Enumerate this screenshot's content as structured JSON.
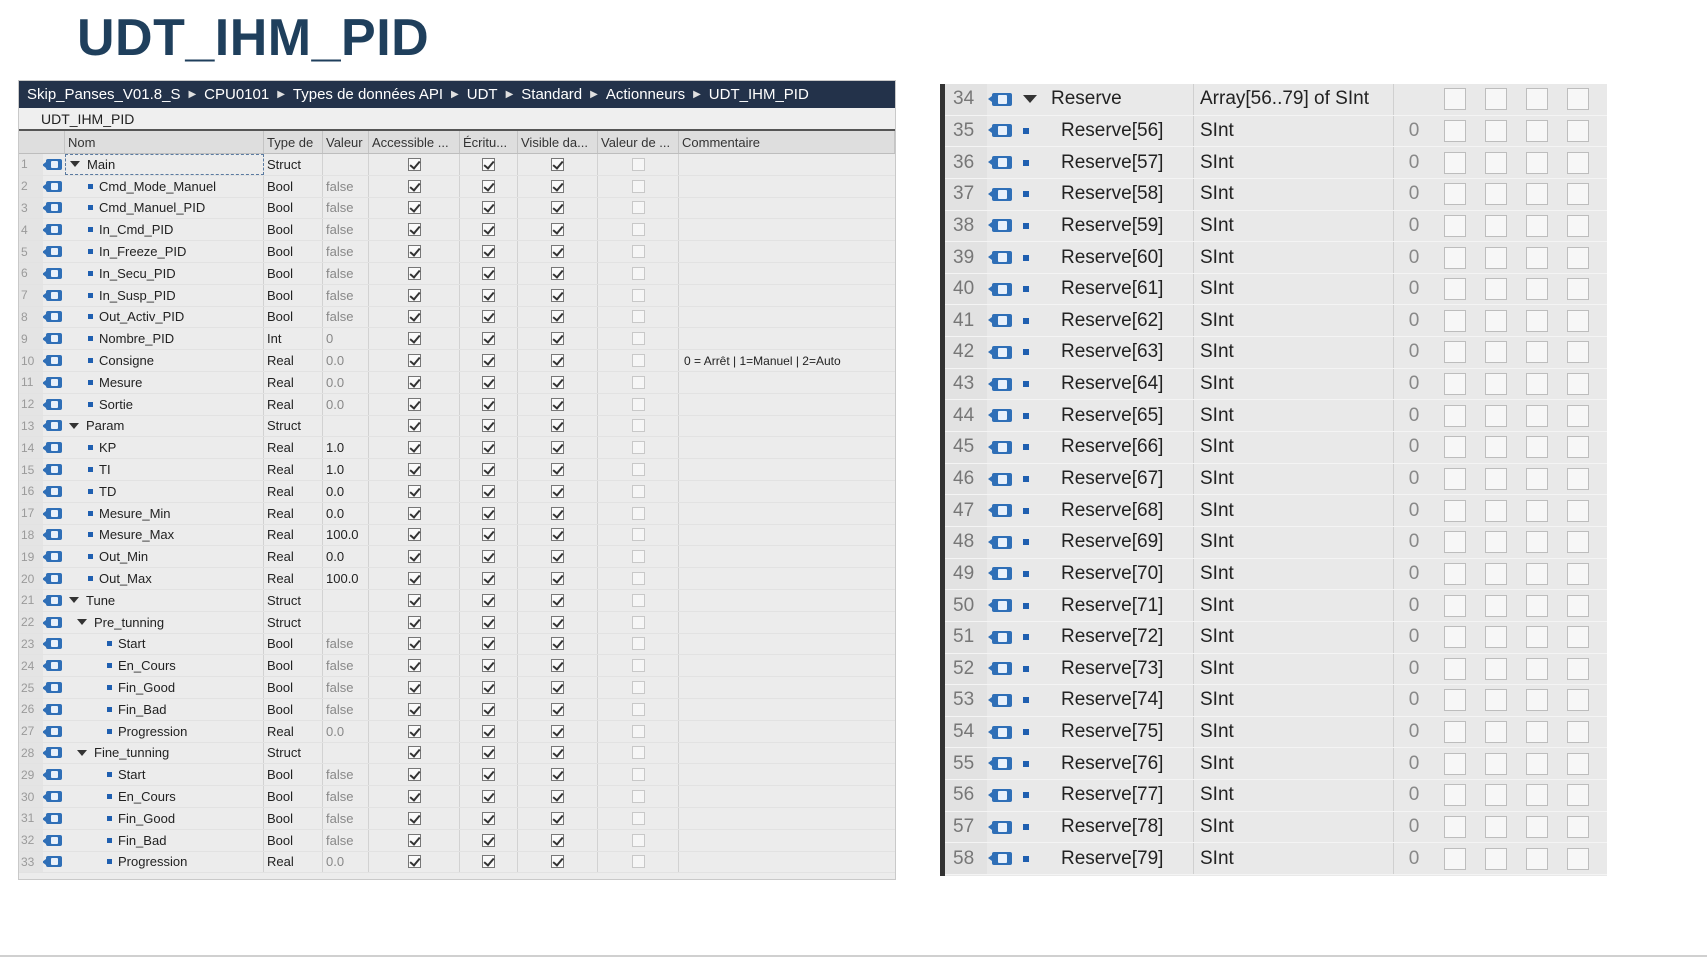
{
  "slide": {
    "title": "UDT_IHM_PID"
  },
  "breadcrumb": [
    "Skip_Panses_V01.8_S",
    "CPU0101",
    "Types de données API",
    "UDT",
    "Standard",
    "Actionneurs",
    "UDT_IHM_PID"
  ],
  "udt_name": "UDT_IHM_PID",
  "columns": [
    "Nom",
    "Type de",
    "Valeur",
    "Accessible ...",
    "Écritu...",
    "Visible da...",
    "Valeur de ...",
    "Commentaire"
  ],
  "rows": [
    {
      "n": "1",
      "name": "Main",
      "type": "Struct",
      "val": "",
      "indent": 0,
      "expand": true,
      "comment": ""
    },
    {
      "n": "2",
      "name": "Cmd_Mode_Manuel",
      "type": "Bool",
      "val": "false",
      "indent": 1,
      "comment": ""
    },
    {
      "n": "3",
      "name": "Cmd_Manuel_PID",
      "type": "Bool",
      "val": "false",
      "indent": 1,
      "comment": ""
    },
    {
      "n": "4",
      "name": "In_Cmd_PID",
      "type": "Bool",
      "val": "false",
      "indent": 1,
      "comment": ""
    },
    {
      "n": "5",
      "name": "In_Freeze_PID",
      "type": "Bool",
      "val": "false",
      "indent": 1,
      "comment": ""
    },
    {
      "n": "6",
      "name": "In_Secu_PID",
      "type": "Bool",
      "val": "false",
      "indent": 1,
      "comment": ""
    },
    {
      "n": "7",
      "name": "In_Susp_PID",
      "type": "Bool",
      "val": "false",
      "indent": 1,
      "comment": ""
    },
    {
      "n": "8",
      "name": "Out_Activ_PID",
      "type": "Bool",
      "val": "false",
      "indent": 1,
      "comment": ""
    },
    {
      "n": "9",
      "name": "Nombre_PID",
      "type": "Int",
      "val": "0",
      "indent": 1,
      "comment": ""
    },
    {
      "n": "10",
      "name": "Consigne",
      "type": "Real",
      "val": "0.0",
      "indent": 1,
      "comment": "0 = Arrêt | 1=Manuel | 2=Auto"
    },
    {
      "n": "11",
      "name": "Mesure",
      "type": "Real",
      "val": "0.0",
      "indent": 1,
      "comment": ""
    },
    {
      "n": "12",
      "name": "Sortie",
      "type": "Real",
      "val": "0.0",
      "indent": 1,
      "comment": ""
    },
    {
      "n": "13",
      "name": "Param",
      "type": "Struct",
      "val": "",
      "indent": 0,
      "expand": true,
      "comment": ""
    },
    {
      "n": "14",
      "name": "KP",
      "type": "Real",
      "val": "1.0",
      "indent": 1,
      "set": true,
      "comment": ""
    },
    {
      "n": "15",
      "name": "TI",
      "type": "Real",
      "val": "1.0",
      "indent": 1,
      "set": true,
      "comment": ""
    },
    {
      "n": "16",
      "name": "TD",
      "type": "Real",
      "val": "0.0",
      "indent": 1,
      "set": true,
      "comment": ""
    },
    {
      "n": "17",
      "name": "Mesure_Min",
      "type": "Real",
      "val": "0.0",
      "indent": 1,
      "set": true,
      "comment": ""
    },
    {
      "n": "18",
      "name": "Mesure_Max",
      "type": "Real",
      "val": "100.0",
      "indent": 1,
      "set": true,
      "comment": ""
    },
    {
      "n": "19",
      "name": "Out_Min",
      "type": "Real",
      "val": "0.0",
      "indent": 1,
      "set": true,
      "comment": ""
    },
    {
      "n": "20",
      "name": "Out_Max",
      "type": "Real",
      "val": "100.0",
      "indent": 1,
      "set": true,
      "comment": ""
    },
    {
      "n": "21",
      "name": "Tune",
      "type": "Struct",
      "val": "",
      "indent": 0,
      "expand": true,
      "comment": ""
    },
    {
      "n": "22",
      "name": "Pre_tunning",
      "type": "Struct",
      "val": "",
      "indent": 1,
      "expand": true,
      "comment": ""
    },
    {
      "n": "23",
      "name": "Start",
      "type": "Bool",
      "val": "false",
      "indent": 2,
      "comment": ""
    },
    {
      "n": "24",
      "name": "En_Cours",
      "type": "Bool",
      "val": "false",
      "indent": 2,
      "comment": ""
    },
    {
      "n": "25",
      "name": "Fin_Good",
      "type": "Bool",
      "val": "false",
      "indent": 2,
      "comment": ""
    },
    {
      "n": "26",
      "name": "Fin_Bad",
      "type": "Bool",
      "val": "false",
      "indent": 2,
      "comment": ""
    },
    {
      "n": "27",
      "name": "Progression",
      "type": "Real",
      "val": "0.0",
      "indent": 2,
      "comment": ""
    },
    {
      "n": "28",
      "name": "Fine_tunning",
      "type": "Struct",
      "val": "",
      "indent": 1,
      "expand": true,
      "comment": ""
    },
    {
      "n": "29",
      "name": "Start",
      "type": "Bool",
      "val": "false",
      "indent": 2,
      "comment": ""
    },
    {
      "n": "30",
      "name": "En_Cours",
      "type": "Bool",
      "val": "false",
      "indent": 2,
      "comment": ""
    },
    {
      "n": "31",
      "name": "Fin_Good",
      "type": "Bool",
      "val": "false",
      "indent": 2,
      "comment": ""
    },
    {
      "n": "32",
      "name": "Fin_Bad",
      "type": "Bool",
      "val": "false",
      "indent": 2,
      "comment": ""
    },
    {
      "n": "33",
      "name": "Progression",
      "type": "Real",
      "val": "0.0",
      "indent": 2,
      "comment": ""
    }
  ],
  "reserve_rows": [
    {
      "n": "34",
      "name": "Reserve",
      "type": "Array[56..79] of SInt",
      "val": "",
      "expand": true
    },
    {
      "n": "35",
      "name": "Reserve[56]",
      "type": "SInt",
      "val": "0"
    },
    {
      "n": "36",
      "name": "Reserve[57]",
      "type": "SInt",
      "val": "0"
    },
    {
      "n": "37",
      "name": "Reserve[58]",
      "type": "SInt",
      "val": "0"
    },
    {
      "n": "38",
      "name": "Reserve[59]",
      "type": "SInt",
      "val": "0"
    },
    {
      "n": "39",
      "name": "Reserve[60]",
      "type": "SInt",
      "val": "0"
    },
    {
      "n": "40",
      "name": "Reserve[61]",
      "type": "SInt",
      "val": "0"
    },
    {
      "n": "41",
      "name": "Reserve[62]",
      "type": "SInt",
      "val": "0"
    },
    {
      "n": "42",
      "name": "Reserve[63]",
      "type": "SInt",
      "val": "0"
    },
    {
      "n": "43",
      "name": "Reserve[64]",
      "type": "SInt",
      "val": "0"
    },
    {
      "n": "44",
      "name": "Reserve[65]",
      "type": "SInt",
      "val": "0"
    },
    {
      "n": "45",
      "name": "Reserve[66]",
      "type": "SInt",
      "val": "0"
    },
    {
      "n": "46",
      "name": "Reserve[67]",
      "type": "SInt",
      "val": "0"
    },
    {
      "n": "47",
      "name": "Reserve[68]",
      "type": "SInt",
      "val": "0"
    },
    {
      "n": "48",
      "name": "Reserve[69]",
      "type": "SInt",
      "val": "0"
    },
    {
      "n": "49",
      "name": "Reserve[70]",
      "type": "SInt",
      "val": "0"
    },
    {
      "n": "50",
      "name": "Reserve[71]",
      "type": "SInt",
      "val": "0"
    },
    {
      "n": "51",
      "name": "Reserve[72]",
      "type": "SInt",
      "val": "0"
    },
    {
      "n": "52",
      "name": "Reserve[73]",
      "type": "SInt",
      "val": "0"
    },
    {
      "n": "53",
      "name": "Reserve[74]",
      "type": "SInt",
      "val": "0"
    },
    {
      "n": "54",
      "name": "Reserve[75]",
      "type": "SInt",
      "val": "0"
    },
    {
      "n": "55",
      "name": "Reserve[76]",
      "type": "SInt",
      "val": "0"
    },
    {
      "n": "56",
      "name": "Reserve[77]",
      "type": "SInt",
      "val": "0"
    },
    {
      "n": "57",
      "name": "Reserve[78]",
      "type": "SInt",
      "val": "0"
    },
    {
      "n": "58",
      "name": "Reserve[79]",
      "type": "SInt",
      "val": "0"
    }
  ],
  "colors": {
    "title": "#1f3f5c",
    "breadcrumb_bg": "#23324a",
    "icon_blue": "#2f6fb7"
  }
}
